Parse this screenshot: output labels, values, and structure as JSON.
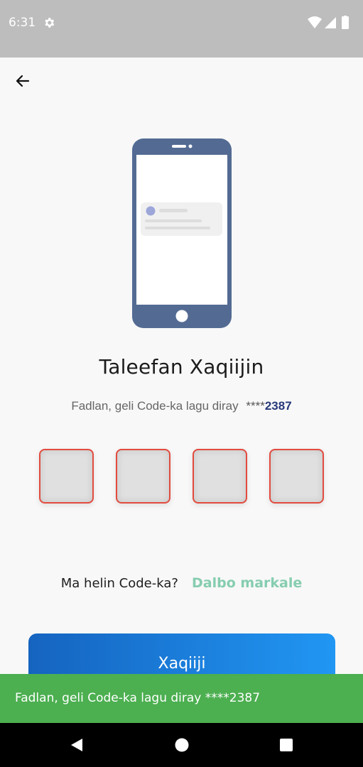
{
  "status_bar": {
    "time": "6:31",
    "icons": [
      "gear-icon",
      "wifi-icon",
      "signal-icon",
      "battery-icon"
    ]
  },
  "header": {
    "back_icon": "arrow-left-icon"
  },
  "illustration": {
    "icon": "smartphone-notification-illustration"
  },
  "main": {
    "title": "Taleefan Xaqiijin",
    "subtitle_prefix": "Fadlan, geli Code-ka lagu diray",
    "masked_stars": "****",
    "masked_digits": "2387",
    "otp_boxes": [
      "",
      "",
      "",
      ""
    ]
  },
  "resend": {
    "question": "Ma helin Code-ka?",
    "link": "Dalbo markale"
  },
  "verify_button": {
    "label": "Xaqiiji"
  },
  "snackbar": {
    "message": "Fadlan, geli Code-ka lagu diray ****2387"
  },
  "nav_bar": {
    "icons": [
      "back-triangle-icon",
      "home-circle-icon",
      "recents-square-icon"
    ]
  },
  "colors": {
    "accent_blue": "#1564c0",
    "otp_border": "#e24b3f",
    "link_green": "#86cdb0",
    "snackbar_green": "#4caf50",
    "digits_navy": "#283a7a"
  }
}
